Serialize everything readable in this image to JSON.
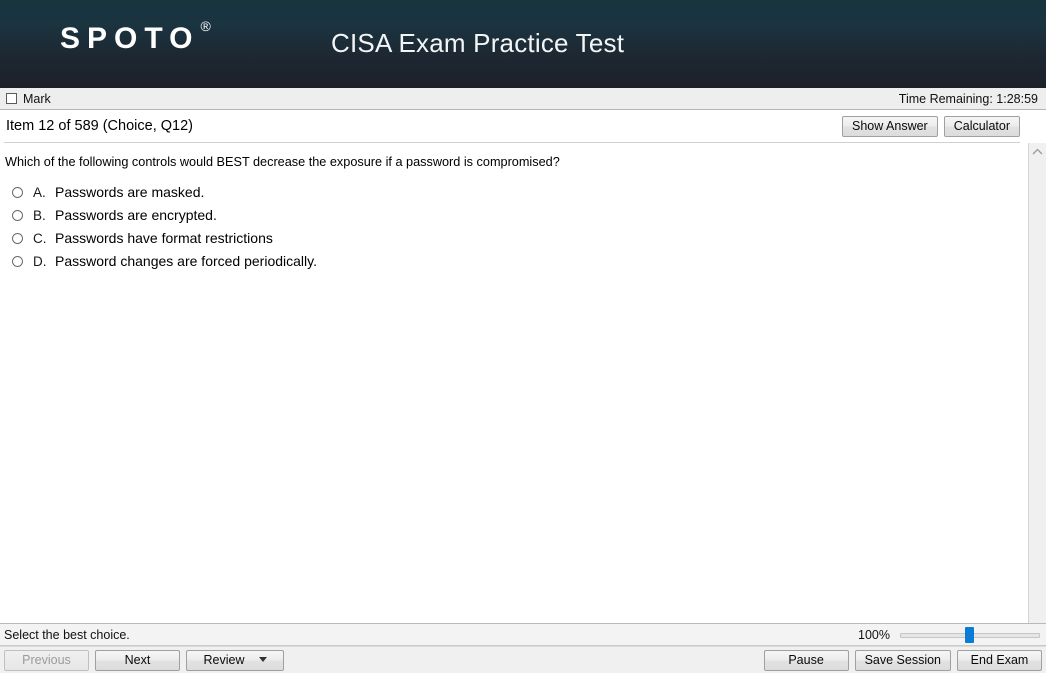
{
  "header": {
    "logo_text": "SPOTO",
    "logo_mark": "®",
    "title": "CISA Exam Practice Test",
    "gradient_top": "#17343f",
    "gradient_bottom": "#1d2029"
  },
  "markbar": {
    "mark_label": "Mark",
    "mark_checked": false,
    "time_remaining": "Time Remaining: 1:28:59"
  },
  "item": {
    "label": "Item 12 of 589 (Choice, Q12)",
    "show_answer_label": "Show Answer",
    "calculator_label": "Calculator"
  },
  "question": {
    "text": "Which of the following controls would BEST decrease the exposure if a password is compromised?",
    "options": [
      {
        "letter": "A.",
        "text": "Passwords are masked.",
        "selected": false
      },
      {
        "letter": "B.",
        "text": "Passwords are encrypted.",
        "selected": false
      },
      {
        "letter": "C.",
        "text": "Passwords have format restrictions",
        "selected": false
      },
      {
        "letter": "D.",
        "text": "Password changes are forced periodically.",
        "selected": false
      }
    ]
  },
  "status": {
    "instruction": "Select the best choice.",
    "zoom_level": "100%",
    "zoom_slider_value": 50
  },
  "footer": {
    "previous_label": "Previous",
    "previous_disabled": true,
    "next_label": "Next",
    "review_label": "Review",
    "pause_label": "Pause",
    "save_session_label": "Save Session",
    "end_exam_label": "End Exam"
  },
  "icons": {
    "scroll_up": "chevron-up-icon",
    "review_caret": "chevron-down-icon"
  },
  "colors": {
    "accent_blue": "#0b7cd4",
    "bar_gray": "#eeeeee"
  }
}
